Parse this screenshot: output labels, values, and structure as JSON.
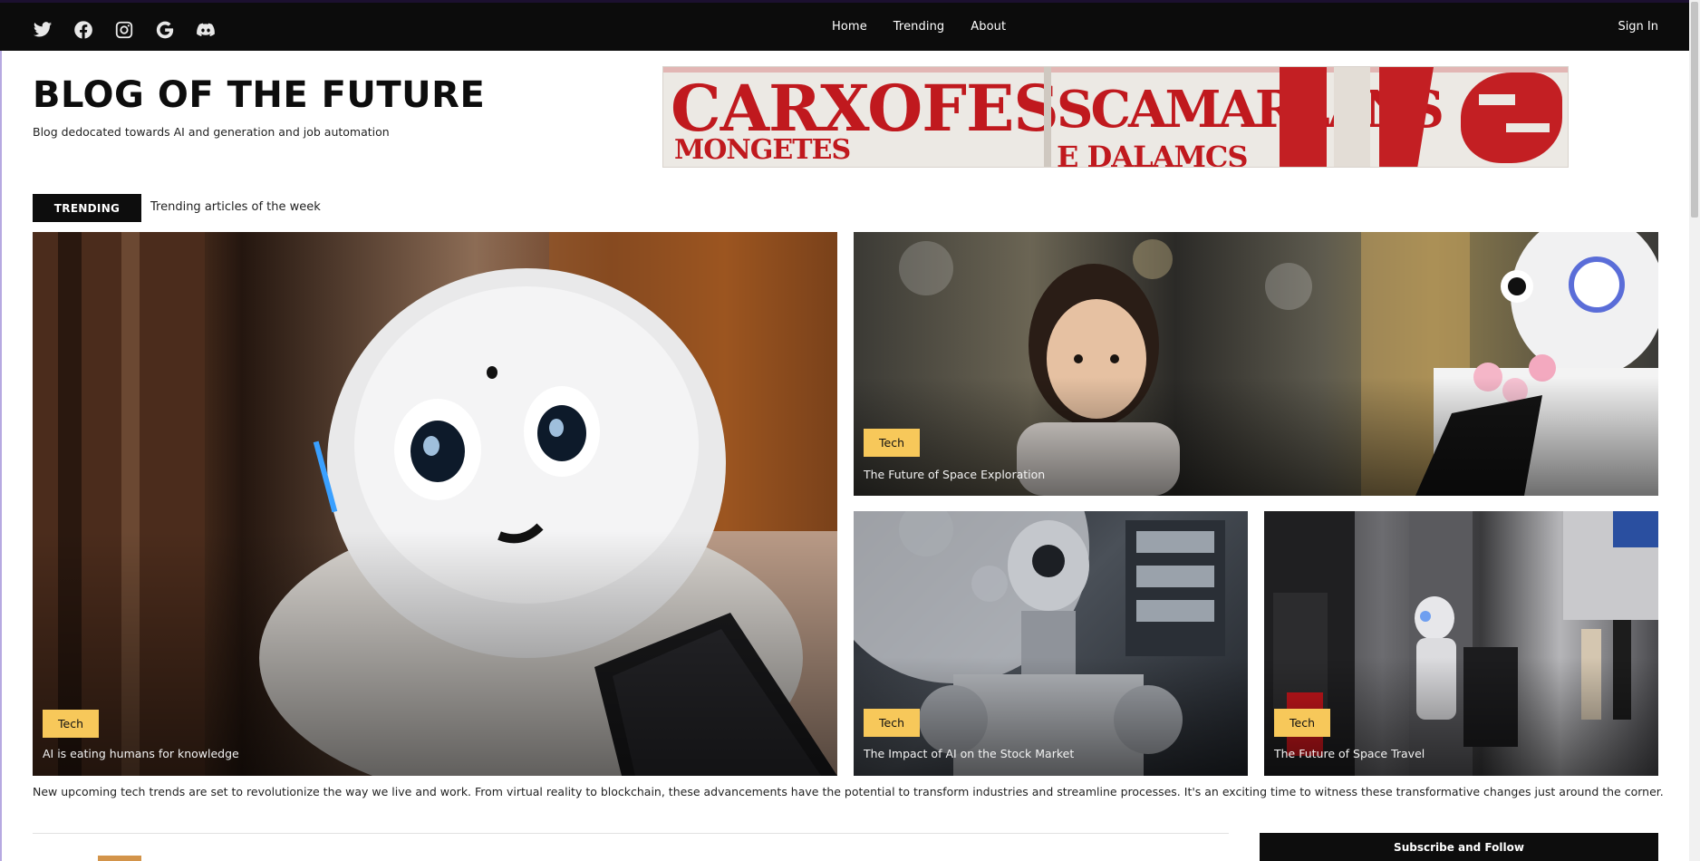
{
  "nav": {
    "social_icons": [
      "twitter-icon",
      "facebook-icon",
      "instagram-icon",
      "google-icon",
      "discord-icon"
    ],
    "links": [
      "Home",
      "Trending",
      "About"
    ],
    "signin": "Sign In"
  },
  "header": {
    "title": "BLOG OF THE FUTURE",
    "tagline": "Blog dedocated towards AI and generation and job automation"
  },
  "banner": {
    "words": [
      "CARXOFES",
      "SCAMARLANS",
      "MONGETES",
      "E DALAMCS"
    ]
  },
  "trending": {
    "tag": "TRENDING",
    "subtitle": "Trending articles of the week"
  },
  "cards": [
    {
      "tag": "Tech",
      "title": "AI is eating humans for knowledge"
    },
    {
      "tag": "Tech",
      "title": "The Future of Space Exploration"
    },
    {
      "tag": "Tech",
      "title": "The Impact of AI on the Stock Market"
    },
    {
      "tag": "Tech",
      "title": "The Future of Space Travel"
    }
  ],
  "summary": "New upcoming tech trends are set to revolutionize the way we live and work. From virtual reality to blockchain, these advancements have the potential to transform industries and streamline processes. It's an exciting time to witness these transformative changes just around the corner.",
  "sidebar": {
    "subscribe": "Subscribe and Follow"
  },
  "colors": {
    "nav_bg": "#0c0c0c",
    "tag_yellow": "#f7c85a",
    "banner_red": "#c31f23"
  }
}
